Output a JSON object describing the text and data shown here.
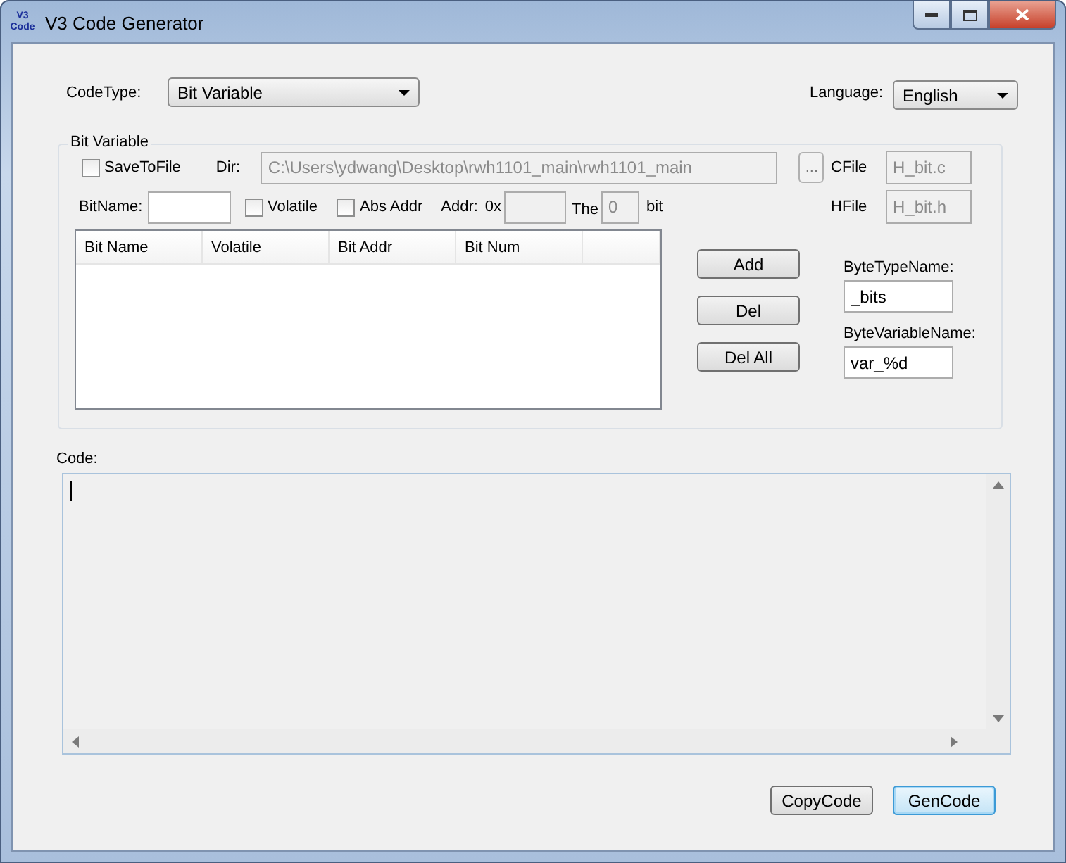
{
  "window": {
    "title": "V3 Code Generator",
    "app_icon_text": [
      "V3",
      "Code"
    ]
  },
  "code_type": {
    "label": "CodeType:",
    "value": "Bit Variable"
  },
  "language": {
    "label": "Language:",
    "value": "English"
  },
  "bit_variable": {
    "title": "Bit Variable",
    "save_to_file": {
      "label": "SaveToFile",
      "checked": false
    },
    "dir": {
      "label": "Dir:",
      "value": "C:\\Users\\ydwang\\Desktop\\rwh1101_main\\rwh1101_main",
      "disabled": true
    },
    "browse_button": "...",
    "cfile": {
      "label": "CFile",
      "value": "H_bit.c",
      "disabled": true
    },
    "bit_name": {
      "label": "BitName:",
      "disabled": false
    },
    "volatile": {
      "label": "Volatile",
      "checked": false
    },
    "abs_addr": {
      "label": "Abs Addr",
      "checked": false
    },
    "addr": {
      "label": "Addr:",
      "prefix": "0x",
      "disabled": true
    },
    "bit_index": {
      "label": "The",
      "value": "0",
      "suffix": "bit",
      "disabled": true
    },
    "hfile": {
      "label": "HFile",
      "value": "H_bit.h",
      "disabled": true
    },
    "table": {
      "columns": [
        "Bit Name",
        "Volatile",
        "Bit Addr",
        "Bit Num"
      ]
    },
    "buttons": [
      "Add",
      "Del",
      "Del All"
    ],
    "byte_type_name": {
      "label": "ByteTypeName:",
      "value": "_bits",
      "disabled": false
    },
    "byte_variable_name": {
      "label": "ByteVariableName:",
      "value": "var_%d",
      "disabled": false
    }
  },
  "code": {
    "label": "Code:"
  },
  "actions": [
    {
      "label": "CopyCode",
      "focused": false
    },
    {
      "label": "GenCode",
      "focused": true
    }
  ]
}
